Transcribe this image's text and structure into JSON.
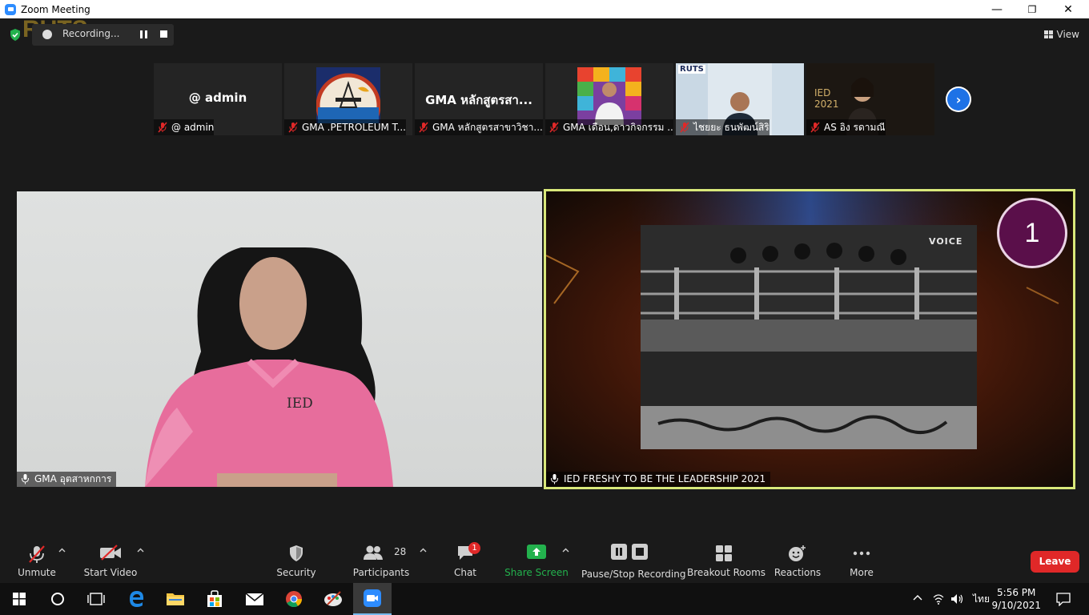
{
  "window": {
    "title": "Zoom Meeting",
    "minimize": "—",
    "maximize": "❐",
    "close": "✕"
  },
  "recording": {
    "status": "Recording...",
    "watermark": "RUTS"
  },
  "view_button": {
    "label": "View"
  },
  "thumbnails": [
    {
      "big_text": "@ admin",
      "label": "@ admin",
      "kind": "text"
    },
    {
      "big_text": "",
      "label": "GMA .PETROLEUM T...",
      "kind": "petroleum"
    },
    {
      "big_text": "GMA หลักสูตรสา...",
      "label": "GMA หลักสูตรสาขาวิชา...",
      "kind": "text"
    },
    {
      "big_text": "",
      "label": "GMA เดือน,ดาวกิจกรรม ...",
      "kind": "video-colorful"
    },
    {
      "big_text": "",
      "label": "ไชยยะ ธนพัฒน์สิริ",
      "kind": "video-office",
      "overlay": "RUTS"
    },
    {
      "big_text": "",
      "label": "AS อิง รดามณี",
      "kind": "video-ied",
      "overlay": "IED 2021"
    }
  ],
  "next_page": {
    "label": "›"
  },
  "tiles": {
    "left": {
      "name": "GMA อุตสาหกการ",
      "shirt_text": "IED"
    },
    "right": {
      "name": "IED FRESHY TO BE THE LEADERSHIP 2021",
      "badge": "1",
      "logo_text": "VOICE"
    }
  },
  "toolbar": {
    "unmute": "Unmute",
    "start_video": "Start Video",
    "security": "Security",
    "participants": "Participants",
    "participants_count": "28",
    "chat": "Chat",
    "chat_badge": "1",
    "share_screen": "Share Screen",
    "pause_stop_recording": "Pause/Stop Recording",
    "breakout_rooms": "Breakout Rooms",
    "reactions": "Reactions",
    "more": "More",
    "leave": "Leave"
  },
  "taskbar": {
    "language": "ไทย",
    "time": "5:56 PM",
    "date": "9/10/2021"
  },
  "colors": {
    "accent_blue": "#2d8cff",
    "share_green": "#23b14d",
    "leave_red": "#e02828",
    "active_speaker_border": "#d9e87a"
  }
}
